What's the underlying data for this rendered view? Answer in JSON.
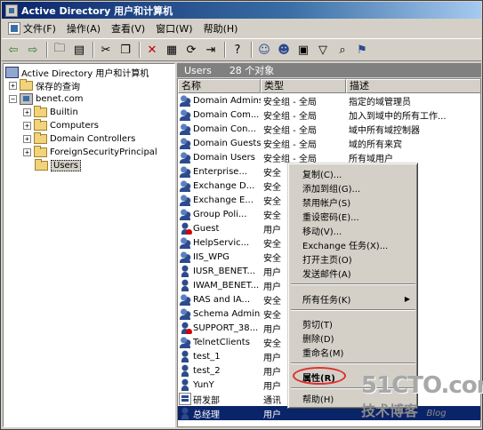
{
  "window": {
    "title": "Active Directory 用户和计算机"
  },
  "menubar": {
    "items": [
      "文件(F)",
      "操作(A)",
      "查看(V)",
      "窗口(W)",
      "帮助(H)"
    ]
  },
  "toolbar": {
    "buttons": [
      "back-arrow-icon",
      "forward-arrow-icon",
      "up-folder-icon",
      "show-hide-tree-icon",
      "cut-icon",
      "copy-icon",
      "delete-icon",
      "properties-icon",
      "refresh-icon",
      "export-list-icon",
      "help-icon",
      "new-user-icon",
      "new-group-icon",
      "new-ou-icon",
      "filter-icon",
      "find-icon",
      "add-to-group-icon"
    ]
  },
  "tree": {
    "root": "Active Directory 用户和计算机",
    "saved_queries": "保存的查询",
    "domain": "benet.com",
    "children": [
      "Builtin",
      "Computers",
      "Domain Controllers",
      "ForeignSecurityPrincipal",
      "Users"
    ],
    "selected": "Users"
  },
  "right_header": {
    "container": "Users",
    "count": "28 个对象"
  },
  "columns": {
    "name": "名称",
    "type": "类型",
    "desc": "描述"
  },
  "rows": [
    {
      "name": "Domain Admins",
      "type": "安全组 - 全局",
      "desc": "指定的域管理员",
      "icon": "group"
    },
    {
      "name": "Domain Com...",
      "type": "安全组 - 全局",
      "desc": "加入到域中的所有工作...",
      "icon": "group"
    },
    {
      "name": "Domain Con...",
      "type": "安全组 - 全局",
      "desc": "域中所有域控制器",
      "icon": "group"
    },
    {
      "name": "Domain Guests",
      "type": "安全组 - 全局",
      "desc": "域的所有来宾",
      "icon": "group"
    },
    {
      "name": "Domain Users",
      "type": "安全组 - 全局",
      "desc": "所有域用户",
      "icon": "group"
    },
    {
      "name": "Enterprise...",
      "type": "安全",
      "desc": "管理员",
      "icon": "group"
    },
    {
      "name": "Exchange D...",
      "type": "安全",
      "desc": "ange D",
      "icon": "group"
    },
    {
      "name": "Exchange E...",
      "type": "安全",
      "desc": "ange E",
      "icon": "group"
    },
    {
      "name": "Group Poli...",
      "type": "安全",
      "desc": "可以修...",
      "icon": "group"
    },
    {
      "name": "Guest",
      "type": "用户",
      "desc": "机或域",
      "icon": "user-disabled"
    },
    {
      "name": "HelpServic...",
      "type": "安全",
      "desc": "组",
      "icon": "group"
    },
    {
      "name": "IIS_WPG",
      "type": "安全",
      "desc": "",
      "icon": "group"
    },
    {
      "name": "IUSR_BENET...",
      "type": "用户",
      "desc": "rnet 信...",
      "icon": "user"
    },
    {
      "name": "IWAM_BENET...",
      "type": "用户",
      "desc": "rnet 信...",
      "icon": "user"
    },
    {
      "name": "RAS and IA...",
      "type": "安全",
      "desc": "器可以...",
      "icon": "group"
    },
    {
      "name": "Schema Admins",
      "type": "安全",
      "desc": "管理员",
      "icon": "group"
    },
    {
      "name": "SUPPORT_38...",
      "type": "用户",
      "desc": "支持服...",
      "icon": "user-disabled"
    },
    {
      "name": "TelnetClients",
      "type": "安全",
      "desc": "访问此...",
      "icon": "group"
    },
    {
      "name": "test_1",
      "type": "用户",
      "desc": "",
      "icon": "user"
    },
    {
      "name": "test_2",
      "type": "用户",
      "desc": "",
      "icon": "user"
    },
    {
      "name": "YunY",
      "type": "用户",
      "desc": "",
      "icon": "user"
    },
    {
      "name": "研发部",
      "type": "通讯",
      "desc": "",
      "icon": "contact"
    },
    {
      "name": "总经理",
      "type": "用户",
      "desc": "",
      "icon": "user",
      "selected": true
    }
  ],
  "context_menu": {
    "items": [
      "复制(C)...",
      "添加到组(G)...",
      "禁用帐户(S)",
      "重设密码(E)...",
      "移动(V)...",
      "Exchange 任务(X)...",
      "打开主页(O)",
      "发送邮件(A)",
      "所有任务(K)",
      "剪切(T)",
      "删除(D)",
      "重命名(M)",
      "属性(R)",
      "帮助(H)"
    ]
  },
  "watermark": {
    "site": "51CTO.com",
    "sub": "技术博客",
    "blog": "Blog"
  }
}
